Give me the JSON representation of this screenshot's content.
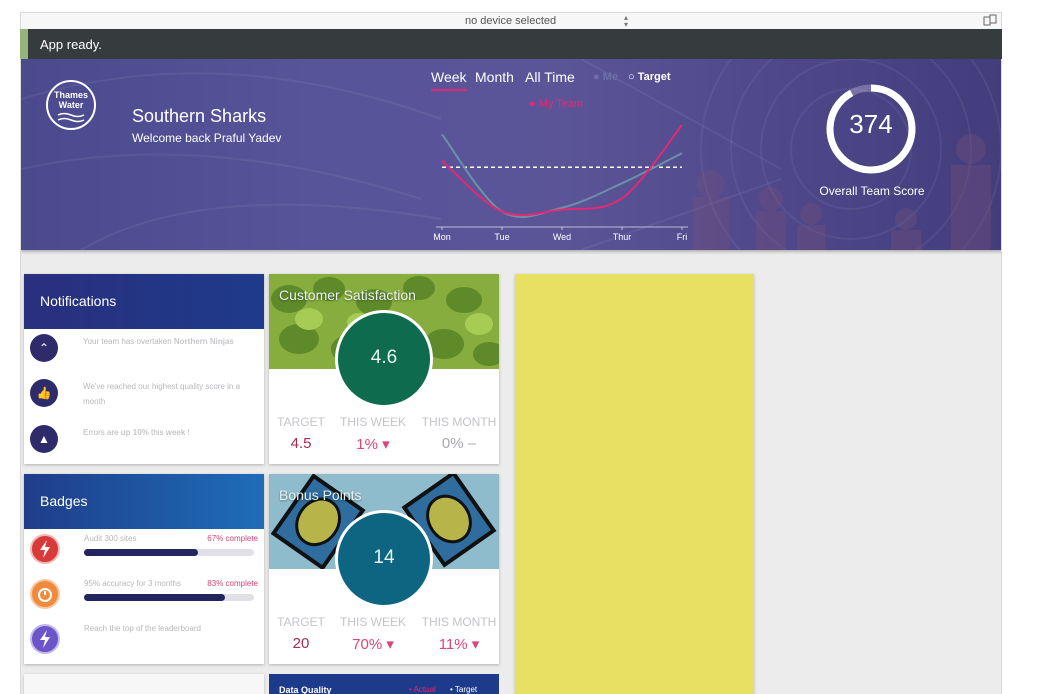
{
  "device_bar": {
    "selected": "no device selected",
    "selector_icon": "up-down-arrows-icon",
    "rotate_icon": "rotate-device-icon"
  },
  "status": {
    "message": "App ready."
  },
  "hero": {
    "logo_text": "Thames Water",
    "team_name": "Southern Sharks",
    "welcome": "Welcome back Praful Yadev",
    "period_tabs": [
      {
        "label": "Week",
        "active": true
      },
      {
        "label": "Month",
        "active": false
      },
      {
        "label": "All Time",
        "active": false
      }
    ],
    "legend": {
      "me": "Me",
      "target": "Target",
      "my_team": "My Team"
    },
    "score": {
      "value": "374",
      "label": "Overall Team Score",
      "fraction": 0.92
    }
  },
  "chart_data": {
    "type": "line",
    "categories": [
      "Mon",
      "Tue",
      "Wed",
      "Thur",
      "Fri"
    ],
    "series": [
      {
        "name": "My Team",
        "color": "#e02a74",
        "values": [
          0.62,
          0.08,
          0.1,
          0.22,
          1.0
        ]
      },
      {
        "name": "Me",
        "color": "#6d8fa8",
        "values": [
          0.9,
          0.08,
          0.12,
          0.38,
          0.7
        ]
      },
      {
        "name": "Target",
        "color": "#ffffff",
        "dashed": true,
        "values": [
          0.55,
          0.55,
          0.55,
          0.55,
          0.55
        ]
      }
    ]
  },
  "notifications": {
    "title": "Notifications",
    "items": [
      {
        "icon": "chevron-up-icon",
        "parts": [
          "Your team has overtaken ",
          "Northern Ninjas",
          ""
        ]
      },
      {
        "icon": "thumbs-up-icon",
        "parts": [
          "We've reached our highest quality score in a month",
          "",
          ""
        ]
      },
      {
        "icon": "warning-icon",
        "parts": [
          "Errors are ",
          "up  10%",
          " this "
        ],
        "tail_bold": "week",
        "tail": " !"
      }
    ]
  },
  "badges": {
    "title": "Badges",
    "items": [
      {
        "icon": "lightning-badge-icon",
        "color": "#d83a3a",
        "label": "Audit 300 sites",
        "pct_label": "67% complete",
        "progress": 0.67
      },
      {
        "icon": "stopwatch-badge-icon",
        "color": "#f08a3c",
        "label": "95% accuracy for 3 months",
        "pct_label": "83% complete",
        "progress": 0.83
      },
      {
        "icon": "lightning-purple-badge-icon",
        "color": "#6b55c8",
        "label": "Reach the top of the leaderboard",
        "pct_label": "",
        "progress": null
      }
    ]
  },
  "kpis": [
    {
      "title": "Customer Satisfaction",
      "value": "4.6",
      "circle_color": "#0f6b4e",
      "cols": [
        {
          "h": "TARGET",
          "v": "4.5",
          "style": "maroon"
        },
        {
          "h": "THIS WEEK",
          "v": "1% ▾",
          "style": "red"
        },
        {
          "h": "THIS MONTH",
          "v": "0% –",
          "style": "grey"
        }
      ]
    },
    {
      "title": "Bonus Points",
      "value": "14",
      "circle_color": "#0e6582",
      "cols": [
        {
          "h": "TARGET",
          "v": "20",
          "style": "maroon"
        },
        {
          "h": "THIS WEEK",
          "v": "70% ▾",
          "style": "red"
        },
        {
          "h": "THIS MONTH",
          "v": "11% ▾",
          "style": "red"
        }
      ]
    }
  ],
  "data_quality": {
    "title": "Data Quality",
    "actual": "• Actual",
    "target": "• Target"
  }
}
